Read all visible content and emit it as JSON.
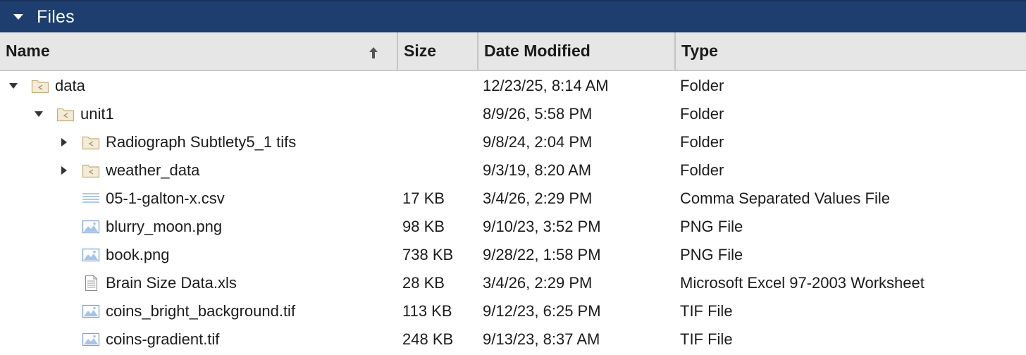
{
  "panel": {
    "title": "Files"
  },
  "columns": {
    "name": "Name",
    "size": "Size",
    "date": "Date Modified",
    "type": "Type"
  },
  "rows": [
    {
      "name": "data",
      "size": "",
      "date": "12/23/25, 8:14 AM",
      "type": "Folder",
      "icon": "folder-icon",
      "depth": 0,
      "toggle": "expanded"
    },
    {
      "name": "unit1",
      "size": "",
      "date": "8/9/26, 5:58 PM",
      "type": "Folder",
      "icon": "folder-icon",
      "depth": 1,
      "toggle": "expanded"
    },
    {
      "name": "Radiograph Subtlety5_1 tifs",
      "size": "",
      "date": "9/8/24, 2:04 PM",
      "type": "Folder",
      "icon": "folder-icon",
      "depth": 2,
      "toggle": "collapsed"
    },
    {
      "name": "weather_data",
      "size": "",
      "date": "9/3/19, 8:20 AM",
      "type": "Folder",
      "icon": "folder-icon",
      "depth": 2,
      "toggle": "collapsed"
    },
    {
      "name": "05-1-galton-x.csv",
      "size": "17 KB",
      "date": "3/4/26, 2:29 PM",
      "type": "Comma Separated Values File",
      "icon": "csv-file-icon",
      "depth": 2,
      "toggle": "none"
    },
    {
      "name": "blurry_moon.png",
      "size": "98 KB",
      "date": "9/10/23, 3:52 PM",
      "type": "PNG File",
      "icon": "image-file-icon",
      "depth": 2,
      "toggle": "none"
    },
    {
      "name": "book.png",
      "size": "738 KB",
      "date": "9/28/22, 1:58 PM",
      "type": "PNG File",
      "icon": "image-file-icon",
      "depth": 2,
      "toggle": "none"
    },
    {
      "name": "Brain Size Data.xls",
      "size": "28 KB",
      "date": "3/4/26, 2:29 PM",
      "type": "Microsoft Excel 97-2003 Worksheet",
      "icon": "document-file-icon",
      "depth": 2,
      "toggle": "none"
    },
    {
      "name": "coins_bright_background.tif",
      "size": "113 KB",
      "date": "9/12/23, 6:25 PM",
      "type": "TIF File",
      "icon": "image-file-icon",
      "depth": 2,
      "toggle": "none"
    },
    {
      "name": "coins-gradient.tif",
      "size": "248 KB",
      "date": "9/13/23, 8:37 AM",
      "type": "TIF File",
      "icon": "image-file-icon",
      "depth": 2,
      "toggle": "none"
    }
  ],
  "colors": {
    "title_bar": "#1d3e6e",
    "header_bg": "#e6e6e6",
    "folder_fill": "#f3ecd8",
    "folder_stroke": "#c2ae7c",
    "image_icon": "#7fa6d6"
  }
}
